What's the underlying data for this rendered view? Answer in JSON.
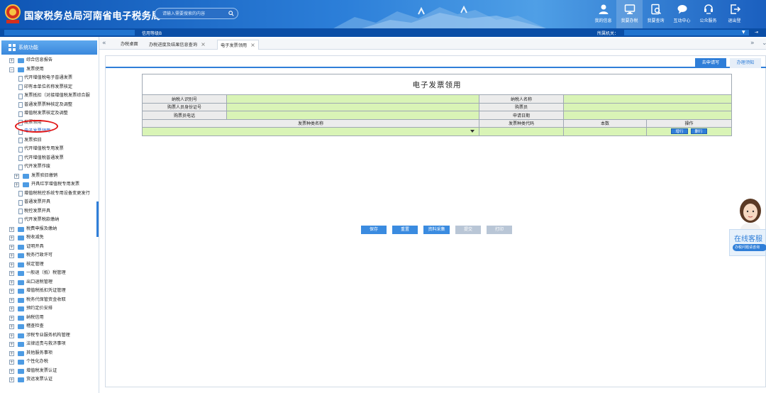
{
  "header": {
    "title": "国家税务总局河南省电子税务局",
    "search_placeholder": "请输入需要搜索的内容",
    "nav": [
      {
        "label": "我的信息",
        "icon": "user-icon"
      },
      {
        "label": "我要办税",
        "icon": "monitor-icon"
      },
      {
        "label": "我要查询",
        "icon": "query-icon"
      },
      {
        "label": "互动中心",
        "icon": "chat-icon"
      },
      {
        "label": "公众服务",
        "icon": "service-icon"
      },
      {
        "label": "退出登",
        "icon": "logout-icon"
      }
    ]
  },
  "subbar": {
    "level": "信用等级B",
    "org_label": "所属机关："
  },
  "sidebar": {
    "title": "系统功能",
    "items": [
      {
        "label": "综合信息报告",
        "level": 0,
        "kind": "folder",
        "expander": "+"
      },
      {
        "label": "发票使用",
        "level": 0,
        "kind": "folder",
        "expander": "−"
      },
      {
        "label": "代开增值税电子普通发票",
        "level": 1,
        "kind": "doc"
      },
      {
        "label": "印有本单位名称发票核定",
        "level": 1,
        "kind": "doc"
      },
      {
        "label": "发票抵扣（对接增值税发票综合服",
        "level": 1,
        "kind": "doc"
      },
      {
        "label": "普通发票票种核定及调整",
        "level": 1,
        "kind": "doc"
      },
      {
        "label": "增值税发票核定及调整",
        "level": 1,
        "kind": "doc"
      },
      {
        "label": "发票领用",
        "level": 1,
        "kind": "doc"
      },
      {
        "label": "电子发票领用",
        "level": 1,
        "kind": "doc",
        "selected": true
      },
      {
        "label": "发票验旧",
        "level": 1,
        "kind": "doc"
      },
      {
        "label": "代开增值税专用发票",
        "level": 1,
        "kind": "doc"
      },
      {
        "label": "代开增值税普通发票",
        "level": 1,
        "kind": "doc"
      },
      {
        "label": "代开发票作废",
        "level": 1,
        "kind": "doc"
      },
      {
        "label": "发票验旧缴销",
        "level": 1,
        "kind": "folder",
        "expander": "+"
      },
      {
        "label": "开具红字增值税专用发票",
        "level": 1,
        "kind": "folder",
        "expander": "+"
      },
      {
        "label": "增值税税控系统专用设备变更发行",
        "level": 1,
        "kind": "doc"
      },
      {
        "label": "普通发票开具",
        "level": 1,
        "kind": "doc"
      },
      {
        "label": "税控发票开具",
        "level": 1,
        "kind": "doc"
      },
      {
        "label": "代开发票税款缴纳",
        "level": 1,
        "kind": "doc"
      },
      {
        "label": "税费申报及缴纳",
        "level": 0,
        "kind": "folder",
        "expander": "+"
      },
      {
        "label": "税收减免",
        "level": 0,
        "kind": "folder",
        "expander": "+"
      },
      {
        "label": "证明开具",
        "level": 0,
        "kind": "folder",
        "expander": "+"
      },
      {
        "label": "税务行政许可",
        "level": 0,
        "kind": "folder",
        "expander": "+"
      },
      {
        "label": "核定管理",
        "level": 0,
        "kind": "folder",
        "expander": "+"
      },
      {
        "label": "一般退（抵）税管理",
        "level": 0,
        "kind": "folder",
        "expander": "+"
      },
      {
        "label": "出口退税管理",
        "level": 0,
        "kind": "folder",
        "expander": "+"
      },
      {
        "label": "增值税抵扣凭证管理",
        "level": 0,
        "kind": "folder",
        "expander": "+"
      },
      {
        "label": "税务代保管资金收取",
        "level": 0,
        "kind": "folder",
        "expander": "+"
      },
      {
        "label": "预约定价安排",
        "level": 0,
        "kind": "folder",
        "expander": "+"
      },
      {
        "label": "纳税信用",
        "level": 0,
        "kind": "folder",
        "expander": "+"
      },
      {
        "label": "稽查检查",
        "level": 0,
        "kind": "folder",
        "expander": "+"
      },
      {
        "label": "涉税专业服务机构管理",
        "level": 0,
        "kind": "folder",
        "expander": "+"
      },
      {
        "label": "法律追责与救济事项",
        "level": 0,
        "kind": "folder",
        "expander": "+"
      },
      {
        "label": "其他服务事项",
        "level": 0,
        "kind": "folder",
        "expander": "+"
      },
      {
        "label": "个性化办税",
        "level": 0,
        "kind": "folder",
        "expander": "+"
      },
      {
        "label": "增值税发票认证",
        "level": 0,
        "kind": "folder",
        "expander": "+"
      },
      {
        "label": "货运发票认证",
        "level": 0,
        "kind": "folder",
        "expander": "+"
      }
    ]
  },
  "tabs": {
    "prev": "«",
    "next": "»",
    "more": "⌄",
    "items": [
      {
        "label": "办税桌面",
        "closable": false
      },
      {
        "label": "办税进度及结果信息查询",
        "closable": true
      },
      {
        "label": "电子发票领用",
        "closable": true,
        "active": true
      }
    ]
  },
  "content": {
    "tabs": [
      "去申请写",
      "办理须知"
    ],
    "form": {
      "title": "电子发票领用",
      "taxpayer_id_label": "纳税人识别号",
      "taxpayer_id_value": "",
      "taxpayer_name_label": "纳税人名称",
      "taxpayer_name_value": "",
      "buyer_id_label": "购票人员身份证号",
      "buyer_id_value": "",
      "buyer_label": "购票员",
      "buyer_value": "",
      "buyer_phone_label": "购票员电话",
      "buyer_phone_value": "",
      "apply_date_label": "申请日期",
      "apply_date_value": "",
      "columns": [
        "发票种类名称",
        "发票种类代码",
        "本数",
        "操作"
      ],
      "row": {
        "invoice_type_name": "",
        "invoice_type_code": "",
        "count": ""
      },
      "row_actions": [
        "增行",
        "删行"
      ]
    },
    "buttons": [
      {
        "label": "保存",
        "enabled": true
      },
      {
        "label": "重置",
        "enabled": true
      },
      {
        "label": "资料采集",
        "enabled": true
      },
      {
        "label": "提交",
        "enabled": false
      },
      {
        "label": "打印",
        "enabled": false
      }
    ]
  },
  "cs_widget": {
    "title": "在线客服",
    "subtitle": "办税问题请咨询"
  },
  "colors": {
    "header_blue": "#0f55b4",
    "accent": "#2f7ed8",
    "field_green": "#d9f4b6",
    "label_gray": "#ececec",
    "annotation_red": "#e21818"
  }
}
